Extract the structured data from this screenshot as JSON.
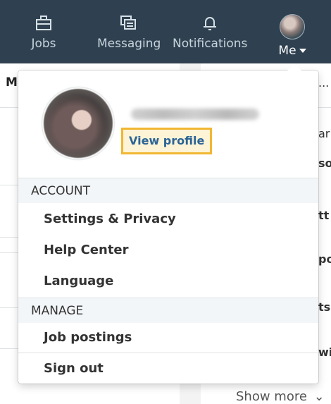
{
  "nav": {
    "jobs": "Jobs",
    "messaging": "Messaging",
    "notifications": "Notifications",
    "me": "Me",
    "icons": [
      "briefcase-icon",
      "messaging-icon",
      "bell-icon",
      "avatar",
      "caret-down-icon"
    ]
  },
  "dropdown": {
    "view_profile": "View profile",
    "account_header": "ACCOUNT",
    "account_items": [
      "Settings & Privacy",
      "Help Center",
      "Language"
    ],
    "manage_header": "MANAGE",
    "manage_items": [
      "Job postings"
    ],
    "sign_out": "Sign out"
  },
  "background": {
    "left_heading": "M",
    "right_snippets": [
      "...",
      "ar",
      "so",
      "tt",
      "po",
      "ts",
      "wi"
    ],
    "show_more": "Show more"
  },
  "colors": {
    "topbar": "#2f4150",
    "highlight_border": "#f2b632",
    "highlight_fill": "#fdf3d6",
    "link": "#2a6496"
  }
}
